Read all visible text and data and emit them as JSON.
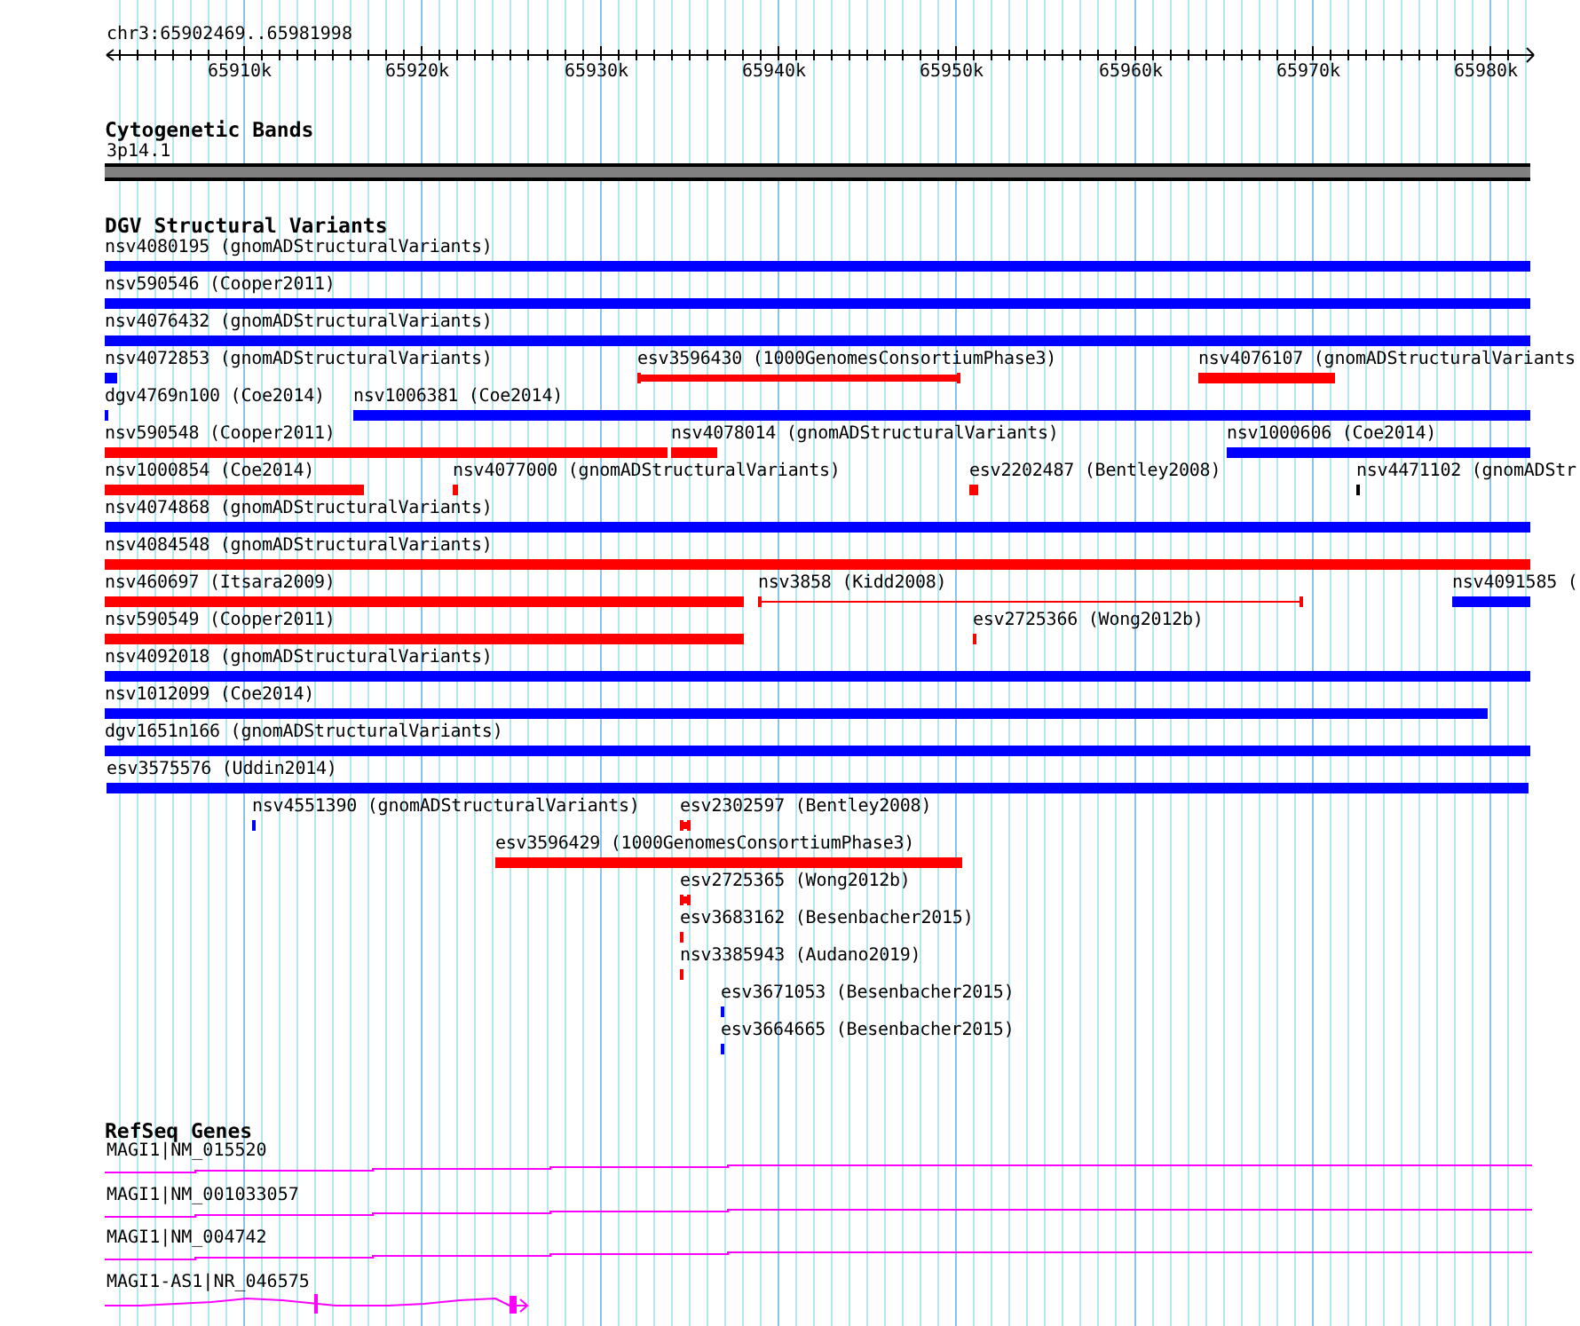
{
  "ruler": {
    "location": "chr3:65902469..65981998",
    "ticks": [
      "65910k",
      "65920k",
      "65930k",
      "65940k",
      "65950k",
      "65960k",
      "65970k",
      "65980k"
    ]
  },
  "tracks": [
    {
      "title": "Cytogenetic Bands",
      "kind": "bands",
      "features": [
        {
          "label": "3p14.1",
          "kind": "band"
        }
      ]
    },
    {
      "title": "DGV Structural Variants",
      "kind": "variants",
      "features": [
        {
          "label": "nsv4080195 (gnomADStructuralVariants)",
          "kind": "bar",
          "color": "#0000ff"
        },
        {
          "label": "nsv590546 (Cooper2011)",
          "kind": "bar",
          "color": "#0000ff"
        },
        {
          "label": "nsv4076432 (gnomADStructuralVariants)",
          "kind": "bar",
          "color": "#0000ff"
        },
        {
          "label": "nsv4072853 (gnomADStructuralVariants)",
          "kind": "bar",
          "color": "#0000ff"
        },
        {
          "label": "esv3596430 (1000GenomesConsortiumPhase3)",
          "kind": "capped",
          "color": "#ff0000"
        },
        {
          "label": "nsv4076107 (gnomADStructuralVariants",
          "kind": "bar",
          "color": "#ff0000"
        },
        {
          "label": "dgv4769n100 (Coe2014)",
          "kind": "bar",
          "color": "#0000ff"
        },
        {
          "label": "nsv1006381 (Coe2014)",
          "kind": "bar",
          "color": "#0000ff"
        },
        {
          "label": "nsv590548 (Cooper2011)",
          "kind": "bar",
          "color": "#ff0000"
        },
        {
          "label": "nsv4078014 (gnomADStructuralVariants)",
          "kind": "bar",
          "color": "#ff0000"
        },
        {
          "label": "nsv1000606 (Coe2014)",
          "kind": "bar",
          "color": "#0000ff"
        },
        {
          "label": "nsv1000854 (Coe2014)",
          "kind": "bar",
          "color": "#ff0000"
        },
        {
          "label": "nsv4077000 (gnomADStructuralVariants)",
          "kind": "bar",
          "color": "#ff0000"
        },
        {
          "label": "esv2202487 (Bentley2008)",
          "kind": "bar",
          "color": "#ff0000"
        },
        {
          "label": "nsv4471102 (gnomADStr",
          "kind": "bar",
          "color": "#000000"
        },
        {
          "label": "nsv4074868 (gnomADStructuralVariants)",
          "kind": "bar",
          "color": "#0000ff"
        },
        {
          "label": "nsv4084548 (gnomADStructuralVariants)",
          "kind": "bar",
          "color": "#ff0000"
        },
        {
          "label": "nsv460697 (Itsara2009)",
          "kind": "bar",
          "color": "#ff0000"
        },
        {
          "label": "nsv3858 (Kidd2008)",
          "kind": "line",
          "color": "#ff0000"
        },
        {
          "label": "nsv4091585 (",
          "kind": "bar",
          "color": "#0000ff"
        },
        {
          "label": "nsv590549 (Cooper2011)",
          "kind": "bar",
          "color": "#ff0000"
        },
        {
          "label": "esv2725366 (Wong2012b)",
          "kind": "bar",
          "color": "#ff0000"
        },
        {
          "label": "nsv4092018 (gnomADStructuralVariants)",
          "kind": "bar",
          "color": "#0000ff"
        },
        {
          "label": "nsv1012099 (Coe2014)",
          "kind": "bar",
          "color": "#0000ff"
        },
        {
          "label": "dgv1651n166 (gnomADStructuralVariants)",
          "kind": "bar",
          "color": "#0000ff"
        },
        {
          "label": "esv3575576 (Uddin2014)",
          "kind": "bar",
          "color": "#0000ff"
        },
        {
          "label": "nsv4551390 (gnomADStructuralVariants)",
          "kind": "bar",
          "color": "#0000ff"
        },
        {
          "label": "esv2302597 (Bentley2008)",
          "kind": "capped",
          "color": "#ff0000"
        },
        {
          "label": "esv3596429 (1000GenomesConsortiumPhase3)",
          "kind": "bar",
          "color": "#ff0000"
        },
        {
          "label": "esv2725365 (Wong2012b)",
          "kind": "capped",
          "color": "#ff0000"
        },
        {
          "label": "esv3683162 (Besenbacher2015)",
          "kind": "bar",
          "color": "#ff0000"
        },
        {
          "label": "nsv3385943 (Audano2019)",
          "kind": "bar",
          "color": "#ff0000"
        },
        {
          "label": "esv3671053 (Besenbacher2015)",
          "kind": "bar",
          "color": "#0000ff"
        },
        {
          "label": "esv3664665 (Besenbacher2015)",
          "kind": "bar",
          "color": "#0000ff"
        }
      ]
    },
    {
      "title": "RefSeq Genes",
      "kind": "genes",
      "features": [
        {
          "label": "MAGI1|NM_015520",
          "kind": "gene"
        },
        {
          "label": "MAGI1|NM_001033057",
          "kind": "gene"
        },
        {
          "label": "MAGI1|NM_004742",
          "kind": "gene"
        },
        {
          "label": "MAGI1-AS1|NR_046575",
          "kind": "antisense"
        }
      ]
    }
  ]
}
